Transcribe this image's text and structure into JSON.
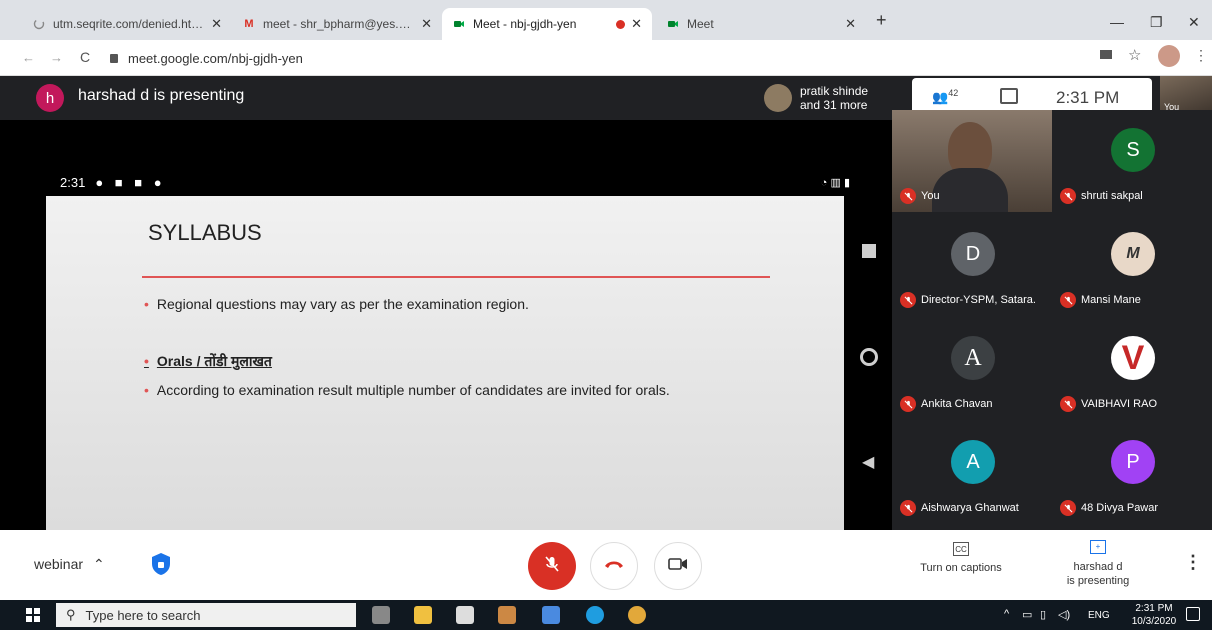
{
  "browser": {
    "tabs": [
      {
        "title": "utm.seqrite.com/denied.html?url=",
        "icon": "loading-icon"
      },
      {
        "title": "meet - shr_bpharm@yes.edu.in",
        "icon": "gmail-icon"
      },
      {
        "title": "Meet - nbj-gjdh-yen",
        "icon": "meet-icon",
        "active": true
      },
      {
        "title": "Meet",
        "icon": "meet-icon"
      }
    ],
    "new_tab": "+",
    "url": "meet.google.com/nbj-gjdh-yen"
  },
  "meet": {
    "presenter_initial": "h",
    "presenter_title": "harshad d is presenting",
    "others_line1": "pratik shinde",
    "others_line2": "and 31 more",
    "participant_count": "42",
    "clock": "2:31 PM",
    "self_label": "You"
  },
  "slide": {
    "phone_time": "2:31",
    "title": "SYLLABUS",
    "bullet1": "Regional questions may vary as per the examination region.",
    "bullet2": "Orals / तोंडी मुलाखत",
    "bullet3": "According to examination result multiple number of candidates are invited for orals."
  },
  "participants": [
    {
      "name": "You",
      "initial": "",
      "color": "#6b5a4a",
      "video": true
    },
    {
      "name": "shruti sakpal",
      "initial": "S",
      "color": "#137333"
    },
    {
      "name": "Director-YSPM, Satara.",
      "initial": "D",
      "color": "#5f6368"
    },
    {
      "name": "Mansi Mane",
      "initial": "M",
      "color": "#e8d8c8"
    },
    {
      "name": "Ankita Chavan",
      "initial": "A",
      "color": "#3c4043"
    },
    {
      "name": "VAIBHAVI RAO",
      "initial": "V",
      "color": "#ffffff"
    },
    {
      "name": "Aishwarya Ghanwat",
      "initial": "A",
      "color": "#129eaf"
    },
    {
      "name": "48 Divya Pawar",
      "initial": "P",
      "color": "#a142f4"
    }
  ],
  "controls": {
    "meeting_name": "webinar",
    "captions_label": "Turn on captions",
    "presenting_line1": "harshad d",
    "presenting_line2": "is presenting"
  },
  "taskbar": {
    "search_placeholder": "Type here to search",
    "lang": "ENG",
    "time": "2:31 PM",
    "date": "10/3/2020"
  }
}
